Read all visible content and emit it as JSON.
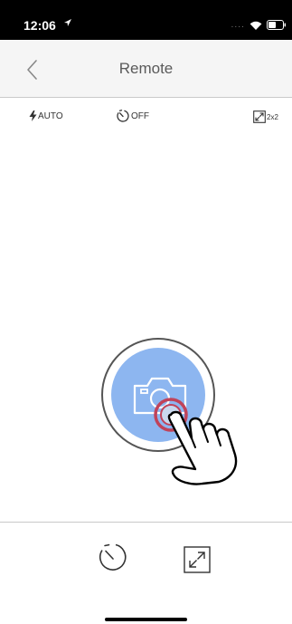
{
  "status_bar": {
    "time": "12:06",
    "signal_dots": "....",
    "icons": [
      "location-arrow-icon",
      "wifi-icon",
      "battery-icon"
    ]
  },
  "nav": {
    "title": "Remote",
    "back_icon": "chevron-left-icon"
  },
  "settings": {
    "flash": {
      "icon": "flash-icon",
      "label": "AUTO"
    },
    "timer": {
      "icon": "self-timer-icon",
      "label": "OFF"
    },
    "print_size": {
      "icon": "expand-icon",
      "label": "2x2"
    }
  },
  "shutter": {
    "icon": "camera-icon",
    "fill_color": "#8db6f0",
    "touch_indicator_color": "#c0435a",
    "hint_icon": "tapping-hand-icon"
  },
  "bottom_toolbar": {
    "items": [
      "self-timer-icon",
      "expand-icon"
    ]
  }
}
